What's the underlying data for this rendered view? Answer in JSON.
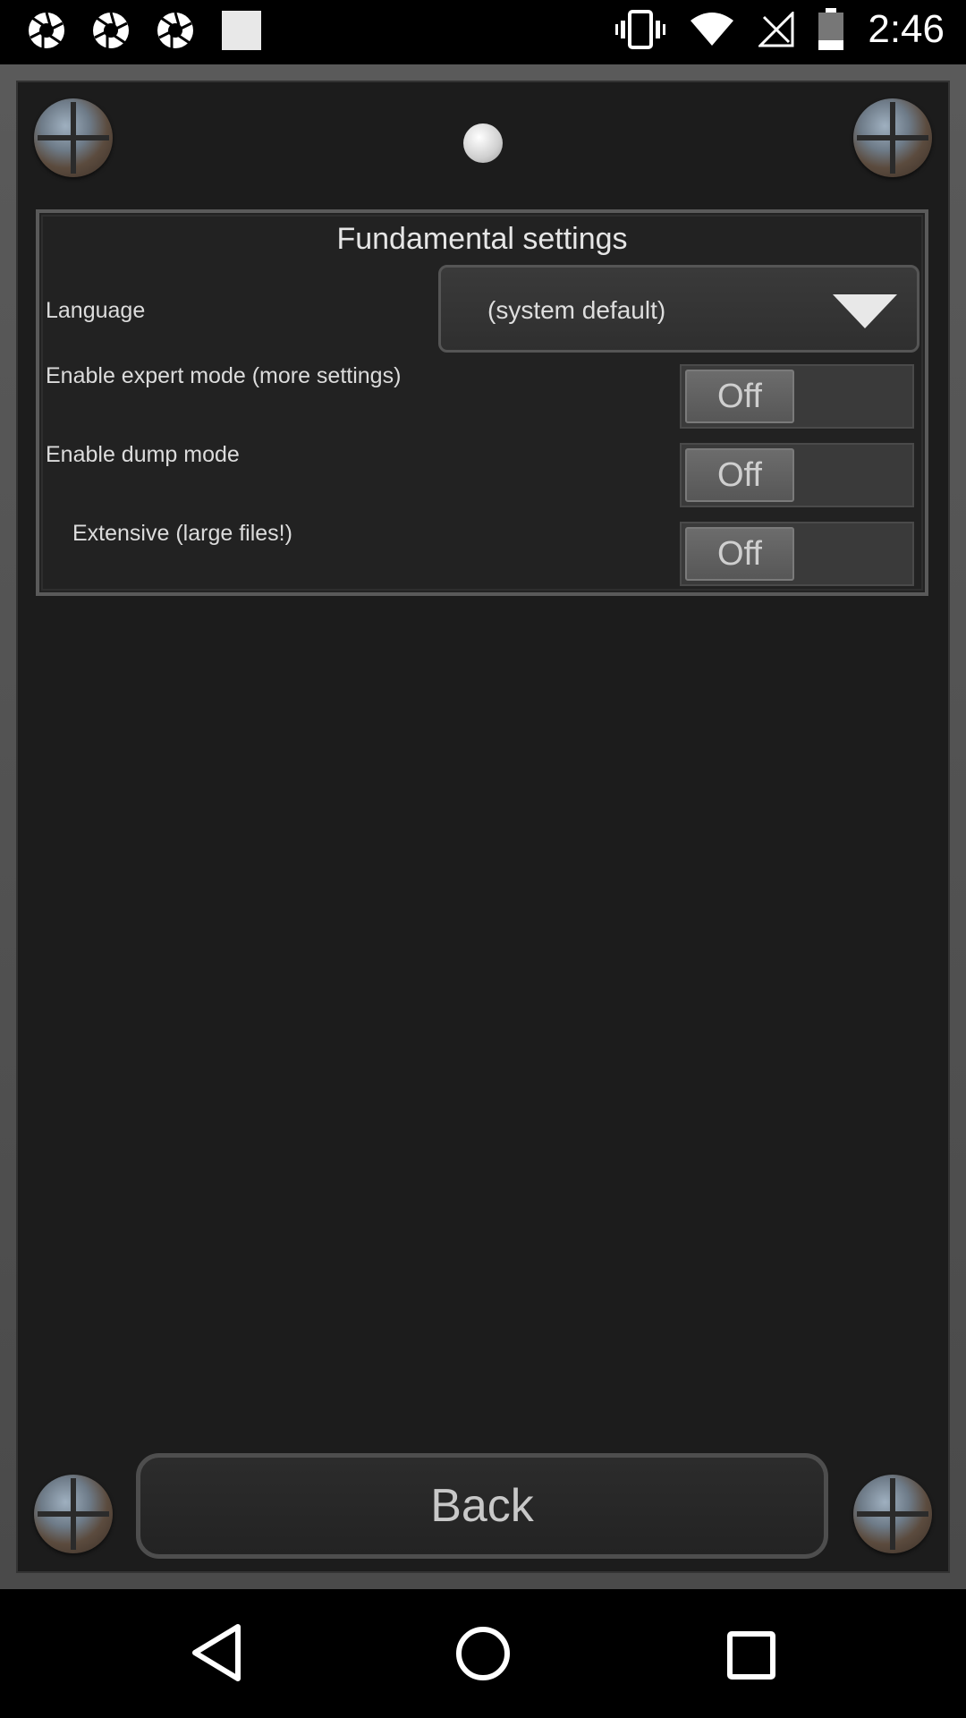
{
  "status_bar": {
    "time": "2:46",
    "left_icons": [
      "aperture-icon",
      "aperture-icon",
      "aperture-icon",
      "image-placeholder-icon"
    ],
    "right_icons": [
      "vibrate-icon",
      "wifi-icon",
      "signal-off-icon",
      "battery-icon"
    ]
  },
  "panel": {
    "title": "Fundamental settings",
    "language_label": "Language",
    "language_value": "(system default)",
    "expert_label": "Enable expert mode (more settings)",
    "expert_value": "Off",
    "dump_label": "Enable dump mode",
    "dump_value": "Off",
    "extensive_label": "Extensive (large files!)",
    "extensive_value": "Off"
  },
  "back_button": {
    "label": "Back"
  },
  "colors": {
    "background": "#1c1c1c",
    "frame": "#5a5a5a",
    "text": "#dcdcdc"
  },
  "nav_bar": {
    "icons": [
      "back-triangle-icon",
      "home-circle-icon",
      "recents-square-icon"
    ]
  }
}
